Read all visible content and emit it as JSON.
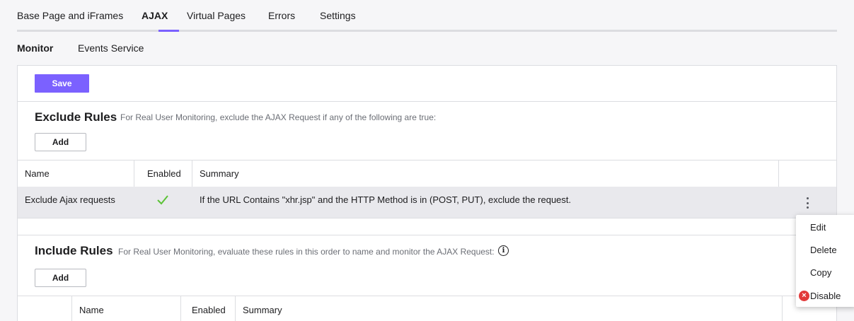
{
  "tabs": {
    "items": [
      "Base Page and iFrames",
      "AJAX",
      "Virtual Pages",
      "Errors",
      "Settings"
    ],
    "active": "AJAX",
    "accent": "#7b61ff"
  },
  "subtabs": {
    "items": [
      "Monitor",
      "Events Service"
    ],
    "active": "Monitor"
  },
  "toolbar": {
    "save_label": "Save"
  },
  "exclude": {
    "title": "Exclude Rules",
    "description": "For Real User Monitoring, exclude the AJAX Request if any of the following are true:",
    "add_label": "Add",
    "columns": [
      "Name",
      "Enabled",
      "Summary"
    ],
    "rows": [
      {
        "name": "Exclude Ajax requests",
        "enabled": "check-icon",
        "summary": "If the URL Contains \"xhr.jsp\" and the HTTP Method is in (POST, PUT), exclude the request."
      }
    ]
  },
  "include": {
    "title": "Include Rules",
    "description": "For Real User Monitoring, evaluate these rules in this order to name and monitor the AJAX Request:",
    "info_icon": "info-icon",
    "add_label": "Add",
    "columns": [
      "Name",
      "Enabled",
      "Summary"
    ]
  },
  "context_menu": {
    "items": [
      "Edit",
      "Delete",
      "Copy",
      "Disable"
    ],
    "disable_icon": "close-circle-icon",
    "disable_icon_color": "#e23a3a"
  },
  "colors": {
    "check": "#5bc236",
    "row_highlight": "#e9e9ed"
  }
}
